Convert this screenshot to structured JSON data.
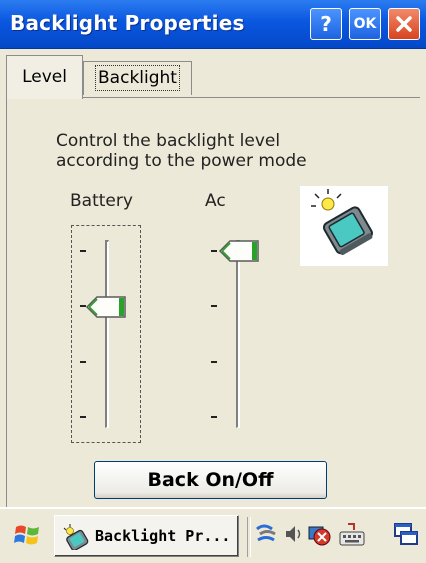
{
  "window": {
    "title": "Backlight Properties",
    "help_label": "?",
    "ok_label": "OK"
  },
  "tabs": [
    {
      "label": "Level",
      "selected": true
    },
    {
      "label": "Backlight",
      "selected": false
    }
  ],
  "level_tab": {
    "description_line1": "Control the backlight level",
    "description_line2": "according to the power mode",
    "battery_label": "Battery",
    "ac_label": "Ac",
    "battery_level_percent": 66,
    "ac_level_percent": 100,
    "back_button_label": "Back On/Off"
  },
  "taskbar": {
    "task_label": "Backlight Pr...",
    "start_icon": "windows-flag-icon",
    "tray_icons": [
      "network-icon",
      "volume-icon",
      "connection-icon",
      "keyboard-icon",
      "desktop-icon"
    ]
  },
  "colors": {
    "titlebar": "#0a57e0",
    "close_button": "#d9431f",
    "slider_thumb_accent": "#2aa22a",
    "background": "#ece9d8"
  }
}
